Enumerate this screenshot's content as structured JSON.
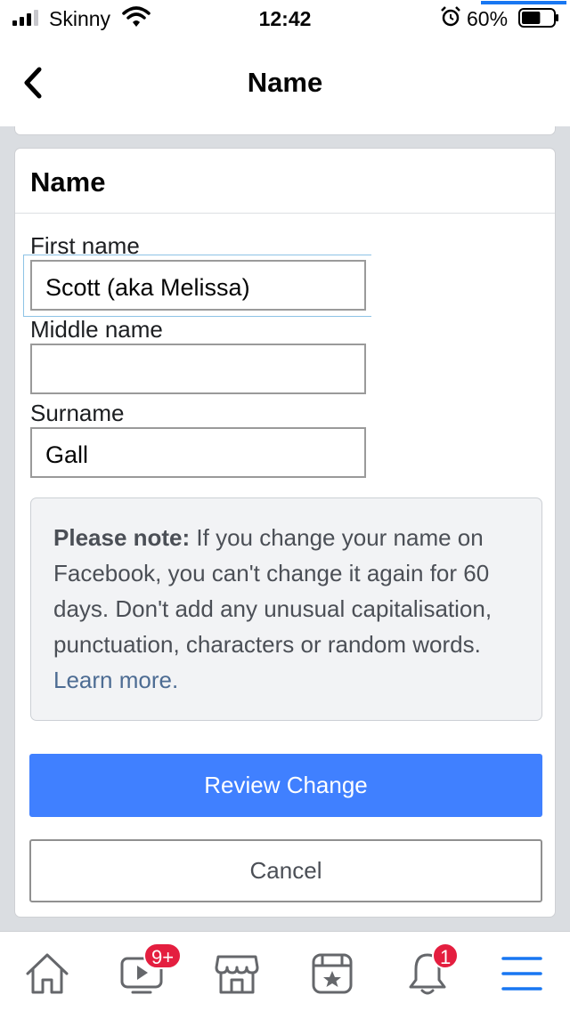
{
  "status_bar": {
    "carrier": "Skinny",
    "time": "12:42",
    "battery_percent": "60%",
    "battery_level": 0.6,
    "icons": [
      "signal-icon",
      "wifi-icon",
      "alarm-icon",
      "battery-icon"
    ]
  },
  "header": {
    "title": "Name",
    "back_icon": "chevron-left-icon"
  },
  "card": {
    "title": "Name",
    "fields": {
      "first": {
        "label": "First name",
        "value": "Scott (aka Melissa)"
      },
      "middle": {
        "label": "Middle name",
        "value": ""
      },
      "surname": {
        "label": "Surname",
        "value": "Gall"
      }
    },
    "note": {
      "strong": "Please note:",
      "body": " If you change your name on Facebook, you can't change it again for 60 days. Don't add any unusual capitalisation, punctuation, characters or random words. ",
      "link": "Learn more",
      "tail": "."
    },
    "review_label": "Review Change",
    "cancel_label": "Cancel"
  },
  "tab_bar": {
    "items": [
      {
        "icon": "home-icon"
      },
      {
        "icon": "video-icon",
        "badge": "9+"
      },
      {
        "icon": "marketplace-icon"
      },
      {
        "icon": "pages-icon"
      },
      {
        "icon": "bell-icon",
        "badge": "1"
      },
      {
        "icon": "menu-icon",
        "active": true
      }
    ]
  },
  "colors": {
    "accent": "#4080ff",
    "active_tab": "#1877f2",
    "badge": "#e41e3f",
    "link": "#4d6c93"
  }
}
